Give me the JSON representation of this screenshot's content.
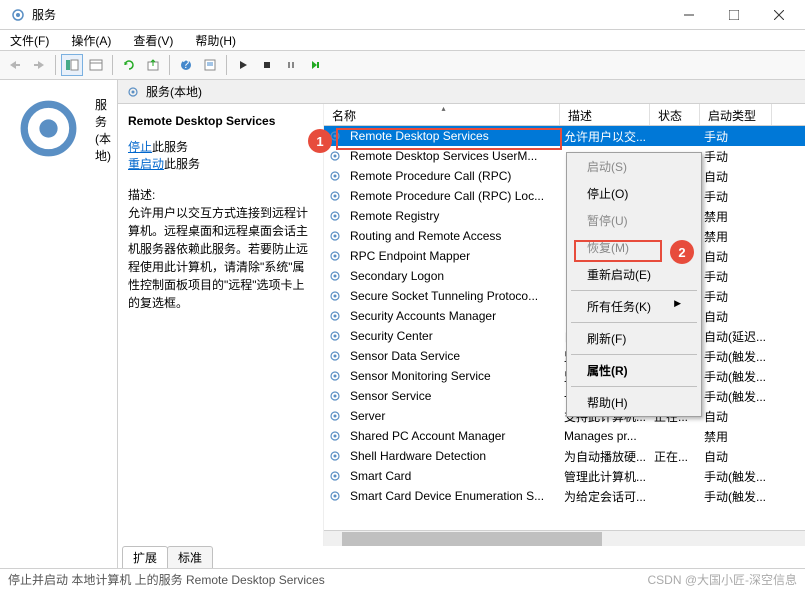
{
  "window": {
    "title": "服务"
  },
  "menubar": {
    "file": "文件(F)",
    "action": "操作(A)",
    "view": "查看(V)",
    "help": "帮助(H)"
  },
  "nav": {
    "local_services": "服务(本地)"
  },
  "content_header": "服务(本地)",
  "detail": {
    "title": "Remote Desktop Services",
    "stop_prefix": "停止",
    "stop_suffix": "此服务",
    "restart_prefix": "重启动",
    "restart_suffix": "此服务",
    "desc_label": "描述:",
    "desc": "允许用户以交互方式连接到远程计算机。远程桌面和远程桌面会话主机服务器依赖此服务。若要防止远程使用此计算机，请清除\"系统\"属性控制面板项目的\"远程\"选项卡上的复选框。"
  },
  "columns": {
    "name": "名称",
    "desc": "描述",
    "state": "状态",
    "start": "启动类型"
  },
  "rows": [
    {
      "name": "Remote Desktop Services",
      "desc": "允许用户以交...",
      "state": "",
      "start": "手动",
      "selected": true
    },
    {
      "name": "Remote Desktop Services UserM...",
      "desc": "",
      "state": "",
      "start": "手动"
    },
    {
      "name": "Remote Procedure Call (RPC)",
      "desc": "",
      "state": "",
      "start": "自动"
    },
    {
      "name": "Remote Procedure Call (RPC) Loc...",
      "desc": "",
      "state": "",
      "start": "手动"
    },
    {
      "name": "Remote Registry",
      "desc": "",
      "state": "",
      "start": "禁用"
    },
    {
      "name": "Routing and Remote Access",
      "desc": "",
      "state": "",
      "start": "禁用"
    },
    {
      "name": "RPC Endpoint Mapper",
      "desc": "",
      "state": "",
      "start": "自动"
    },
    {
      "name": "Secondary Logon",
      "desc": "",
      "state": "",
      "start": "手动"
    },
    {
      "name": "Secure Socket Tunneling Protoco...",
      "desc": "",
      "state": "",
      "start": "手动"
    },
    {
      "name": "Security Accounts Manager",
      "desc": "",
      "state": "",
      "start": "自动"
    },
    {
      "name": "Security Center",
      "desc": "自合体感器...",
      "state": "",
      "start": "自动(延迟..."
    },
    {
      "name": "Sensor Data Service",
      "desc": "监视各种传感...",
      "state": "",
      "start": "手动(触发..."
    },
    {
      "name": "Sensor Monitoring Service",
      "desc": "监视各种传感...",
      "state": "",
      "start": "手动(触发..."
    },
    {
      "name": "Sensor Service",
      "desc": "一项用于管理...",
      "state": "",
      "start": "手动(触发..."
    },
    {
      "name": "Server",
      "desc": "支持此计算机...",
      "state": "正在...",
      "start": "自动"
    },
    {
      "name": "Shared PC Account Manager",
      "desc": "Manages pr...",
      "state": "",
      "start": "禁用"
    },
    {
      "name": "Shell Hardware Detection",
      "desc": "为自动播放硬...",
      "state": "正在...",
      "start": "自动"
    },
    {
      "name": "Smart Card",
      "desc": "管理此计算机...",
      "state": "",
      "start": "手动(触发..."
    },
    {
      "name": "Smart Card Device Enumeration S...",
      "desc": "为给定会话可...",
      "state": "",
      "start": "手动(触发..."
    }
  ],
  "context_menu": {
    "start": "启动(S)",
    "stop": "停止(O)",
    "pause": "暂停(U)",
    "resume": "恢复(M)",
    "restart": "重新启动(E)",
    "all_tasks": "所有任务(K)",
    "refresh": "刷新(F)",
    "properties": "属性(R)",
    "help": "帮助(H)"
  },
  "tabs": {
    "extended": "扩展",
    "standard": "标准"
  },
  "statusbar": "停止并启动 本地计算机 上的服务 Remote Desktop Services",
  "watermark": "CSDN @大国小匠-深空信息",
  "markers": {
    "one": "1",
    "two": "2"
  }
}
